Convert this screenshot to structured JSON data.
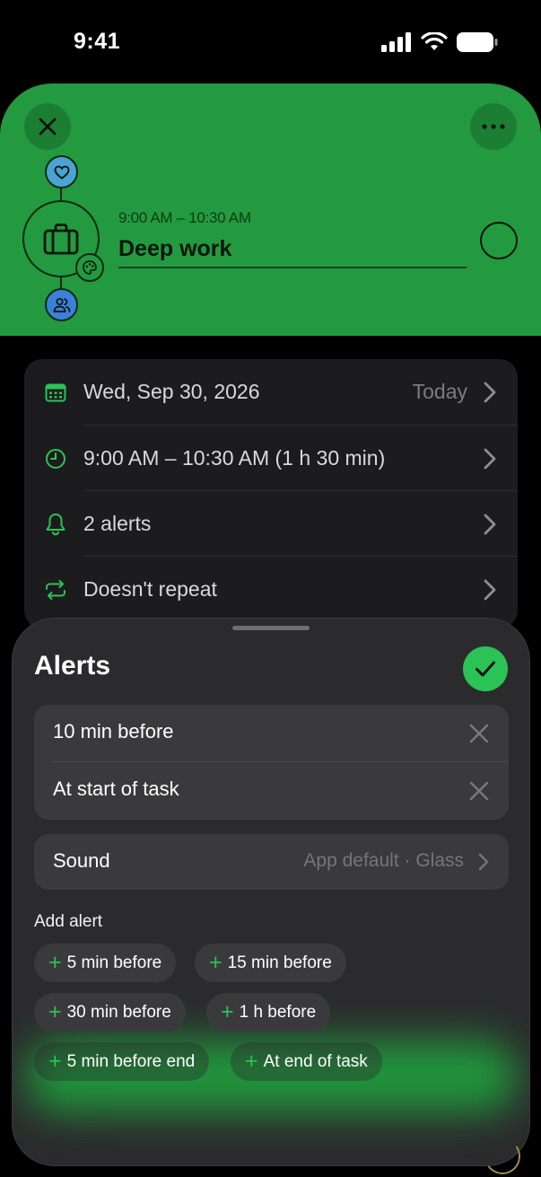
{
  "status_bar": {
    "time": "9:41"
  },
  "header": {
    "task_time": "9:00 AM – 10:30 AM",
    "task_title": "Deep work",
    "colors": {
      "background": "#239a3f",
      "heart_node": "#4aa3d3",
      "people_node": "#3d7fd9"
    }
  },
  "details": {
    "date": {
      "label": "Wed, Sep 30, 2026",
      "value": "Today",
      "icon": "calendar-icon"
    },
    "time": {
      "label": "9:00 AM – 10:30 AM (1 h 30 min)",
      "icon": "clock-icon"
    },
    "alerts": {
      "label": "2 alerts",
      "icon": "bell-icon"
    },
    "repeat": {
      "label": "Doesn't repeat",
      "icon": "repeat-icon"
    }
  },
  "alerts_sheet": {
    "title": "Alerts",
    "alerts": [
      {
        "label": "10 min before"
      },
      {
        "label": "At start of task"
      }
    ],
    "sound": {
      "label": "Sound",
      "value": "App default · Glass"
    },
    "add_title": "Add alert",
    "add_options": [
      {
        "label": "5 min before"
      },
      {
        "label": "15 min before"
      },
      {
        "label": "30 min before"
      },
      {
        "label": "1 h before"
      },
      {
        "label": "5 min before end"
      },
      {
        "label": "At end of task"
      }
    ],
    "accent": "#2bc256"
  }
}
